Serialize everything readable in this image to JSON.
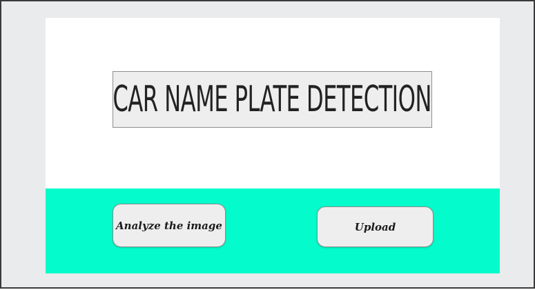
{
  "app": {
    "title": "CAR NAME PLATE DETECTION"
  },
  "actions": {
    "analyze_label": "Analyze the image",
    "upload_label": "Upload"
  },
  "colors": {
    "window_background": "#e9ebec",
    "panel_background": "#ffffff",
    "action_bar": "#04fbcb",
    "button_background": "#eeeeee",
    "title_box_background": "#eeeeee"
  }
}
